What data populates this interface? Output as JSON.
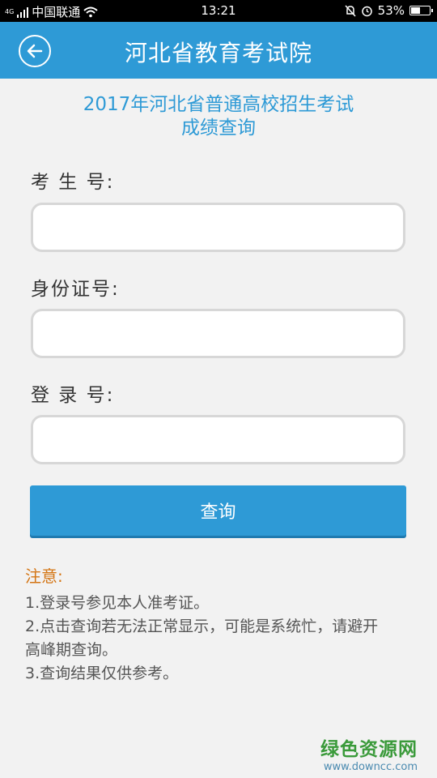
{
  "status_bar": {
    "carrier": "中国联通",
    "network": "4G",
    "time": "13:21",
    "battery": "53%",
    "battery_level": 0.53
  },
  "app_bar": {
    "title": "河北省教育考试院"
  },
  "form": {
    "heading_line1": "2017年河北省普通高校招生考试",
    "heading_line2": "成绩查询",
    "exam_no_label": "考 生 号:",
    "exam_no_value": "",
    "id_no_label": "身份证号:",
    "id_no_value": "",
    "login_no_label": "登 录 号:",
    "login_no_value": "",
    "submit_label": "查询"
  },
  "notice": {
    "title": "注意:",
    "items": [
      "1.登录号参见本人准考证。",
      "2.点击查询若无法正常显示，可能是系统忙，请避开",
      "高峰期查询。",
      "3.查询结果仅供参考。"
    ]
  },
  "watermark": {
    "name": "绿色资源网",
    "url": "www.downcc.com"
  },
  "colors": {
    "accent": "#2e9ad6",
    "notice": "#d47514"
  }
}
